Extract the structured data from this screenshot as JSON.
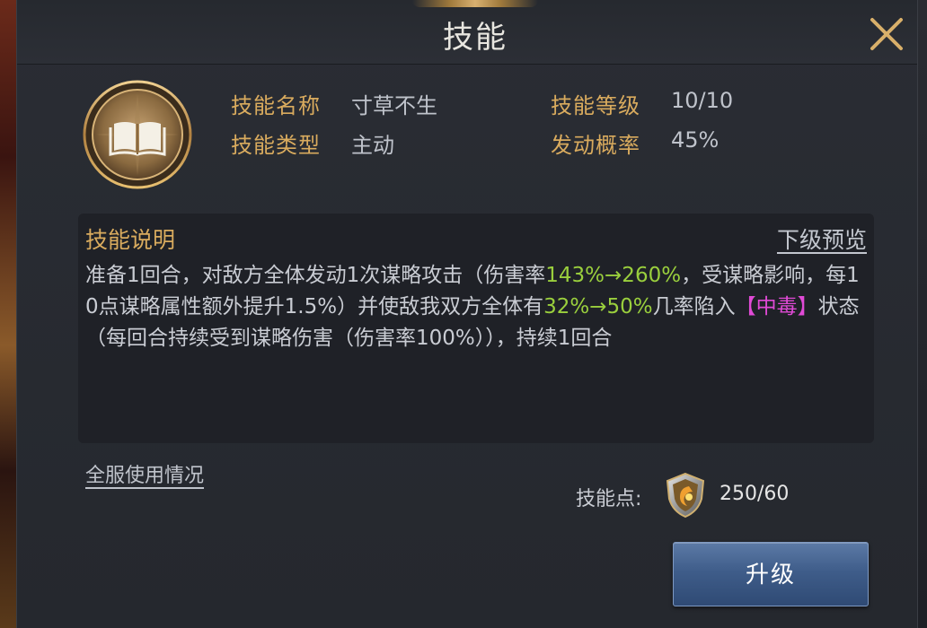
{
  "dialog": {
    "title": "技能",
    "close_icon": "close-icon"
  },
  "skill": {
    "icon": "book-icon",
    "name_label": "技能名称",
    "name_value": "寸草不生",
    "level_label": "技能等级",
    "level_value": "10/10",
    "type_label": "技能类型",
    "type_value": "主动",
    "rate_label": "发动概率",
    "rate_value": "45%"
  },
  "description": {
    "title": "技能说明",
    "preview_link": "下级预览",
    "segments": [
      {
        "text": "准备1回合，对敌方全体发动1次谋略攻击（伤害率",
        "color": "normal"
      },
      {
        "text": "143%→260%",
        "color": "green"
      },
      {
        "text": "，受谋略影响，每10点谋略属性额外提升1.5%）并使敌我双方全体有",
        "color": "normal"
      },
      {
        "text": "32%→50%",
        "color": "green"
      },
      {
        "text": "几率陷入",
        "color": "normal"
      },
      {
        "text": "【中毒】",
        "color": "magenta"
      },
      {
        "text": "状态（每回合持续受到谋略伤害（伤害率100%）），持续1回合",
        "color": "normal"
      }
    ]
  },
  "footer": {
    "usage_link": "全服使用情况",
    "points_label": "技能点:",
    "points_icon": "skill-point-shield-icon",
    "points_value": "250/60",
    "upgrade_button": "升级"
  },
  "colors": {
    "gold_label": "#d9ab5e",
    "highlight_green": "#9acf3d",
    "highlight_magenta": "#e04ad6",
    "button_blue": "#3f5d8a"
  }
}
